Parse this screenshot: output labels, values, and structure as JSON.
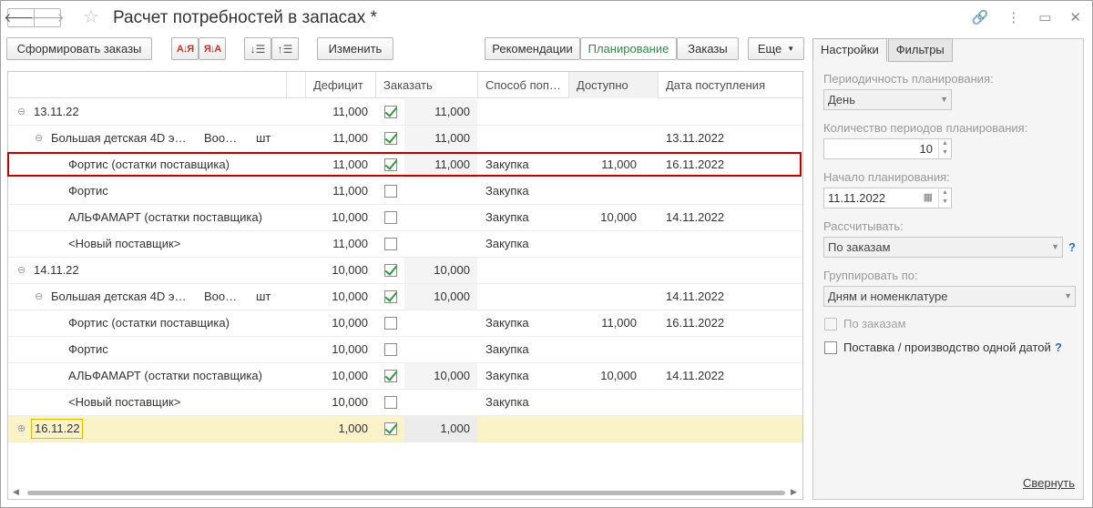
{
  "window": {
    "title": "Расчет потребностей в запасах *",
    "icons": [
      "link-icon",
      "more-icon",
      "minimize-icon",
      "close-icon"
    ]
  },
  "toolbar": {
    "generate_orders": "Сформировать заказы",
    "edit": "Изменить",
    "modes": [
      "Рекомендации",
      "Планирование",
      "Заказы"
    ],
    "active_mode": "Планирование",
    "more": "Еще"
  },
  "table": {
    "columns": [
      "Дефицит",
      "Заказать",
      "Способ поп…",
      "Доступно",
      "Дата поступления"
    ],
    "rows": [
      {
        "level": 0,
        "toggle": "⊖",
        "name": "13.11.22",
        "extra": "",
        "unit": "",
        "deficit": "11,000",
        "checked": true,
        "order": "11,000",
        "method": "",
        "available": "",
        "date": ""
      },
      {
        "level": 1,
        "toggle": "⊖",
        "name": "Большая детская 4D э…",
        "extra": "Воо…",
        "unit": "шт",
        "deficit": "11,000",
        "checked": true,
        "order": "11,000",
        "method": "",
        "available": "",
        "date": "13.11.2022"
      },
      {
        "level": 2,
        "toggle": "",
        "name": "Фортис (остатки поставщика)",
        "extra": "",
        "unit": "",
        "deficit": "11,000",
        "checked": true,
        "order": "11,000",
        "method": "Закупка",
        "available": "11,000",
        "date": "16.11.2022"
      },
      {
        "level": 2,
        "toggle": "",
        "name": "Фортис",
        "extra": "",
        "unit": "",
        "deficit": "11,000",
        "checked": false,
        "order": "",
        "method": "Закупка",
        "available": "",
        "date": ""
      },
      {
        "level": 2,
        "toggle": "",
        "name": "АЛЬФАМАРТ (остатки поставщика)",
        "extra": "",
        "unit": "",
        "deficit": "10,000",
        "checked": false,
        "order": "",
        "method": "Закупка",
        "available": "10,000",
        "date": "14.11.2022"
      },
      {
        "level": 2,
        "toggle": "",
        "name": "<Новый поставщик>",
        "extra": "",
        "unit": "",
        "deficit": "11,000",
        "checked": false,
        "order": "",
        "method": "Закупка",
        "available": "",
        "date": ""
      },
      {
        "level": 0,
        "toggle": "⊖",
        "name": "14.11.22",
        "extra": "",
        "unit": "",
        "deficit": "10,000",
        "checked": true,
        "order": "10,000",
        "method": "",
        "available": "",
        "date": ""
      },
      {
        "level": 1,
        "toggle": "⊖",
        "name": "Большая детская 4D э…",
        "extra": "Воо…",
        "unit": "шт",
        "deficit": "10,000",
        "checked": true,
        "order": "10,000",
        "method": "",
        "available": "",
        "date": "14.11.2022"
      },
      {
        "level": 2,
        "toggle": "",
        "name": "Фортис (остатки поставщика)",
        "extra": "",
        "unit": "",
        "deficit": "10,000",
        "checked": false,
        "order": "",
        "method": "Закупка",
        "available": "11,000",
        "date": "16.11.2022"
      },
      {
        "level": 2,
        "toggle": "",
        "name": "Фортис",
        "extra": "",
        "unit": "",
        "deficit": "10,000",
        "checked": false,
        "order": "",
        "method": "Закупка",
        "available": "",
        "date": ""
      },
      {
        "level": 2,
        "toggle": "",
        "name": "АЛЬФАМАРТ (остатки поставщика)",
        "extra": "",
        "unit": "",
        "deficit": "10,000",
        "checked": true,
        "order": "10,000",
        "method": "Закупка",
        "available": "10,000",
        "date": "14.11.2022"
      },
      {
        "level": 2,
        "toggle": "",
        "name": "<Новый поставщик>",
        "extra": "",
        "unit": "",
        "deficit": "10,000",
        "checked": false,
        "order": "",
        "method": "Закупка",
        "available": "",
        "date": ""
      },
      {
        "level": 0,
        "toggle": "⊕",
        "name": "16.11.22",
        "extra": "",
        "unit": "",
        "deficit": "1,000",
        "checked": true,
        "order": "1,000",
        "method": "",
        "available": "",
        "date": "",
        "selected": true
      }
    ]
  },
  "panel": {
    "tabs": [
      "Настройки",
      "Фильтры"
    ],
    "active_tab": "Настройки",
    "periodicity_label": "Периодичность планирования:",
    "periodicity_value": "День",
    "periods_count_label": "Количество периодов планирования:",
    "periods_count_value": "10",
    "start_label": "Начало планирования:",
    "start_value": "11.11.2022",
    "calculate_label": "Рассчитывать:",
    "calculate_value": "По заказам",
    "group_label": "Группировать по:",
    "group_value": "Дням и номенклатуре",
    "by_orders_label": "По заказам",
    "by_orders_checked": false,
    "single_date_label": "Поставка / производство одной датой",
    "single_date_checked": false,
    "help_mark": "?",
    "collapse_link": "Свернуть"
  },
  "colors": {
    "accent_green": "#2e8b46",
    "highlight_frame": "#c00000",
    "selected_row": "#fbf3c8",
    "check_green": "#2c9a3a"
  }
}
